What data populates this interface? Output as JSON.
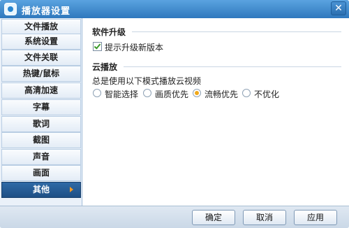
{
  "window": {
    "title": "播放器设置",
    "icon": "player-logo-icon",
    "close_icon": "close-icon",
    "close_glyph": "✕"
  },
  "sidebar": {
    "items": [
      {
        "label": "文件播放",
        "active": false
      },
      {
        "label": "系统设置",
        "active": false
      },
      {
        "label": "文件关联",
        "active": false
      },
      {
        "label": "热键/鼠标",
        "active": false
      },
      {
        "label": "高清加速",
        "active": false
      },
      {
        "label": "字幕",
        "active": false
      },
      {
        "label": "歌词",
        "active": false
      },
      {
        "label": "截图",
        "active": false
      },
      {
        "label": "声音",
        "active": false
      },
      {
        "label": "画面",
        "active": false
      },
      {
        "label": "其他",
        "active": true
      }
    ]
  },
  "upgrade": {
    "title": "软件升级",
    "checkbox_label": "提示升级新版本",
    "checked": true
  },
  "cloud": {
    "title": "云播放",
    "description": "总是使用以下模式播放云视频",
    "options": [
      {
        "label": "智能选择",
        "checked": false
      },
      {
        "label": "画质优先",
        "checked": false
      },
      {
        "label": "流畅优先",
        "checked": true
      },
      {
        "label": "不优化",
        "checked": false
      }
    ]
  },
  "footer": {
    "ok_label": "确定",
    "cancel_label": "取消",
    "apply_label": "应用"
  },
  "colors": {
    "title_bar": "#3c86c6",
    "active_item": "#2f6aa6",
    "check_mark": "#3b9b2a",
    "radio_selected": "#f0a81a"
  }
}
